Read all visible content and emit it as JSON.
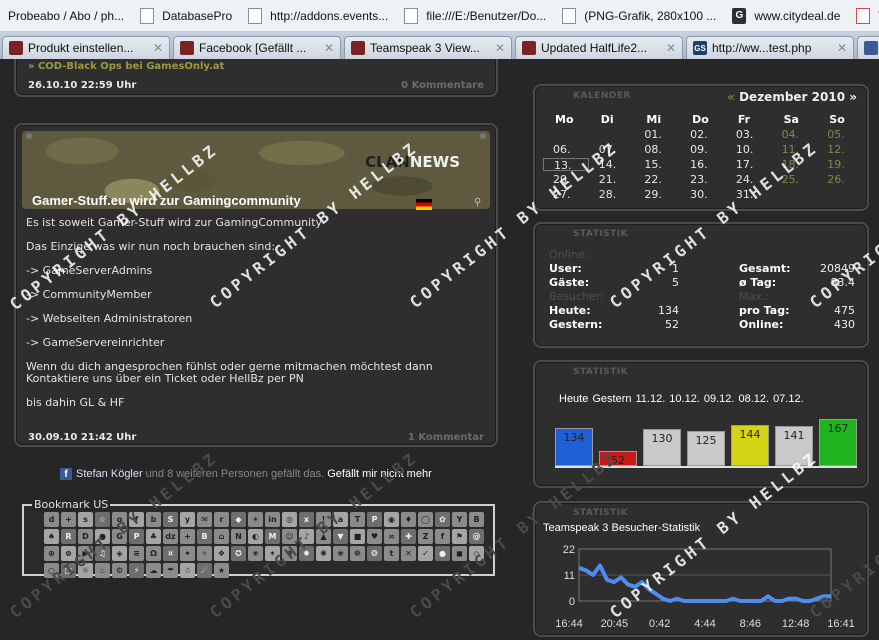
{
  "bookmarks": [
    {
      "label": "Probeabo / Abo / ph...",
      "icon": "none"
    },
    {
      "label": "DatabasePro",
      "icon": "page"
    },
    {
      "label": "http://addons.events...",
      "icon": "page"
    },
    {
      "label": "file:///E:/Benutzer/Do...",
      "icon": "page"
    },
    {
      "label": "(PNG-Grafik, 280x100 ...",
      "icon": "page"
    },
    {
      "label": "www.citydeal.de",
      "icon": "G"
    },
    {
      "label": "Welcom",
      "icon": "welcome"
    }
  ],
  "tabs": [
    {
      "label": "Produkt einstellen...",
      "icon": "clan"
    },
    {
      "label": "Facebook [Gefällt ...",
      "icon": "clan"
    },
    {
      "label": "Teamspeak 3 View...",
      "icon": "clan"
    },
    {
      "label": "Updated HalfLife2...",
      "icon": "clan"
    },
    {
      "label": "http://ww...test.php",
      "icon": "GS"
    },
    {
      "label": "",
      "icon": "facebook"
    }
  ],
  "news_top": {
    "more_link": "» COD-Black Ops bei GamesOnly.at",
    "date": "26.10.10 22:59 Uhr",
    "comments": "0 Kommentare"
  },
  "news_main": {
    "banner": {
      "clan": "CLAN",
      "news": "NEWS"
    },
    "title": "Gamer-Stuff.eu wird zur Gamingcommunity",
    "paragraphs": [
      "Es ist soweit Gamer-Stuff wird zur GamingCommunity",
      "Das Einzige was wir nun noch brauchen sind:",
      "-> GameServerAdmins",
      "-> CommunityMember",
      "-> Webseiten Administratoren",
      "-> GameServereinrichter",
      "Wenn du dich angesprochen fühlst oder gerne mitmachen möchtest dann Kontaktiere uns über ein Ticket oder HellBz per PN",
      "bis dahin GL & HF"
    ],
    "date": "30.09.10 21:42 Uhr",
    "comments": "1 Kommentar"
  },
  "facebook": {
    "name": "Stefan Kögler",
    "rest": "und 8 weiteren Personen gefällt das.",
    "action": "Gefällt mir nicht mehr"
  },
  "bookmark_us": {
    "label": "Bookmark US",
    "icons": [
      "d",
      "+",
      "s",
      "☆",
      "o",
      "f",
      "b",
      "S",
      "y",
      "✉",
      "r",
      "◆",
      "☀",
      "in",
      "◎",
      "x",
      "!",
      "a",
      "T",
      "P",
      "◉",
      "♦",
      "◯",
      "✿",
      "Y",
      "B",
      "♠",
      "R",
      "D",
      "●",
      "G",
      "P",
      "♣",
      "dz",
      "+",
      "B",
      "⌂",
      "N",
      "◐",
      "M",
      "☺",
      "♪",
      "▲",
      "▼",
      "■",
      "♥",
      "∞",
      "✚",
      "Z",
      "f",
      "⚑",
      "@",
      "⊕",
      "⊗",
      "▶",
      "♫",
      "◈",
      "≡",
      "Ω",
      "¤",
      "✦",
      "✧",
      "❖",
      "✪",
      "✬",
      "✶",
      "✸",
      "✹",
      "✺",
      "❀",
      "❁",
      "❂",
      "t",
      "✕",
      "✓",
      "●",
      "◼",
      "◇",
      "○",
      "□",
      "☼",
      "♨",
      "⚙",
      "⚡",
      "☁",
      "☂",
      "☃",
      "☄",
      "★"
    ]
  },
  "calendar": {
    "header": "KALENDER",
    "month": "Dezember 2010",
    "prev": "«",
    "next": "»",
    "weekdays": [
      "Mo",
      "Di",
      "Mi",
      "Do",
      "Fr",
      "Sa",
      "So"
    ],
    "days": [
      "",
      "",
      "01.",
      "02.",
      "03.",
      "04.",
      "05.",
      "06.",
      "07.",
      "08.",
      "09.",
      "10.",
      "11.",
      "12.",
      "13.",
      "14.",
      "15.",
      "16.",
      "17.",
      "18.",
      "19.",
      "20.",
      "21.",
      "22.",
      "23.",
      "24.",
      "25.",
      "26.",
      "27.",
      "28.",
      "29.",
      "30.",
      "31.",
      "",
      ""
    ]
  },
  "statistik": {
    "header": "STATISTIK",
    "online_label": "Online:",
    "besucher_label": "Besucher:",
    "max_label": "Max.:",
    "user_label": "User:",
    "user_value": "1",
    "gaeste_label": "Gäste:",
    "gaeste_value": "5",
    "gesamt_label": "Gesamt:",
    "gesamt_value": "20849",
    "tag_label": "ø Tag:",
    "tag_value": "83.4",
    "heute_label": "Heute:",
    "heute_value": "134",
    "gestern_label": "Gestern:",
    "gestern_value": "52",
    "protag_label": "pro Tag:",
    "protag_value": "475",
    "max_online_label": "Online:",
    "max_online_value": "430"
  },
  "bar_stats": {
    "header": "STATISTIK",
    "chart_data": {
      "type": "bar",
      "categories": [
        "Heute",
        "Gestern",
        "11.12.",
        "10.12.",
        "09.12.",
        "08.12.",
        "07.12."
      ],
      "values": [
        134,
        52,
        130,
        125,
        144,
        141,
        167
      ],
      "colors": [
        "#1f5fd6",
        "#c81a1a",
        "#c9c9c9",
        "#c9c9c9",
        "#d4d414",
        "#c9c9c9",
        "#1fb51f"
      ],
      "ylim": [
        0,
        170
      ]
    }
  },
  "teamspeak": {
    "header": "STATISTIK",
    "title": "Teamspeak 3 Besucher-Statistik",
    "chart_data": {
      "type": "line",
      "y_ticks": [
        "22",
        "11",
        "0"
      ],
      "x_ticks": [
        "16:44",
        "20:45",
        "0:42",
        "4:44",
        "8:46",
        "12:48",
        "16:41"
      ],
      "ylim": [
        0,
        22
      ],
      "values": [
        14,
        13,
        11,
        15,
        9,
        8,
        10,
        7,
        6,
        8,
        5,
        3,
        1,
        0,
        1,
        0,
        0,
        0,
        0,
        0,
        0,
        0,
        1,
        0,
        0,
        0,
        0,
        2,
        0,
        0,
        1,
        1,
        0,
        0,
        1,
        2,
        2
      ],
      "color": "#4d8cf0"
    }
  },
  "watermark": "COPYRIGHT BY HELLBZ"
}
